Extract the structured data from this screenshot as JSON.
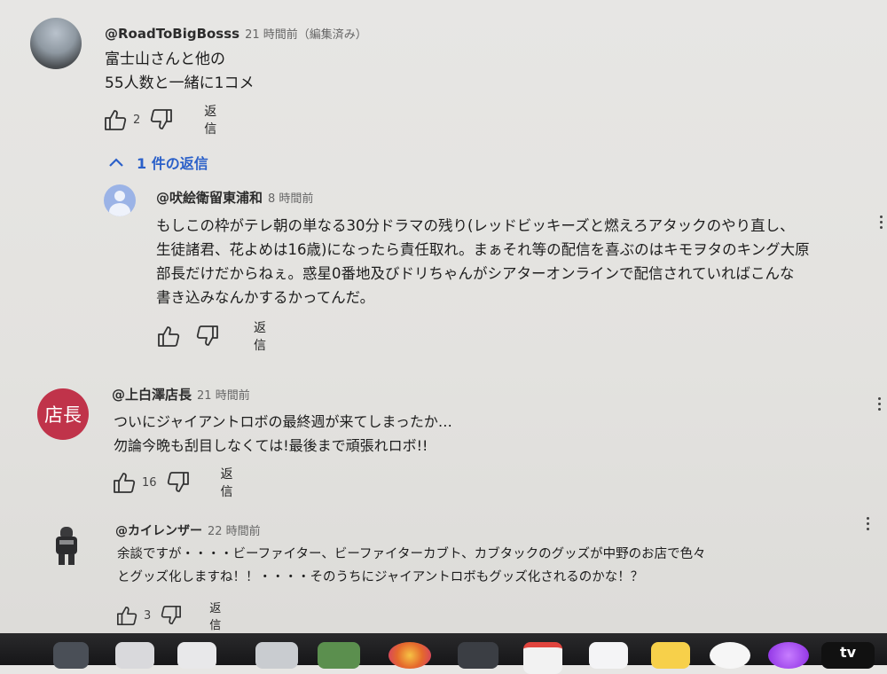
{
  "comments": [
    {
      "handle": "@RoadToBigBosss",
      "time": "21 時間前（編集済み）",
      "lines": [
        "富士山さんと他の",
        "55人数と一緒に1コメ"
      ],
      "likes": "2",
      "reply_label": "返信",
      "replies_toggle": "1 件の返信"
    },
    {
      "handle": "@吠絵衛留東浦和",
      "time": "8 時間前",
      "lines": [
        "もしこの枠がテレ朝の単なる30分ドラマの残り(レッドビッキーズと燃えろアタックのやり直し、",
        "生徒諸君、花よめは16歳)になったら責任取れ。まぁそれ等の配信を喜ぶのはキモヲタのキング大原",
        "部長だけだからねぇ。惑星0番地及びドリちゃんがシアターオンラインで配信されていればこんな",
        "書き込みなんかするかってんだ。"
      ],
      "likes": "",
      "reply_label": "返信"
    },
    {
      "handle": "@上白澤店長",
      "time": "21 時間前",
      "avatar_text": "店長",
      "lines": [
        "ついにジャイアントロボの最終週が来てしまったか…",
        "勿論今晩も刮目しなくては!最後まで頑張れロボ!!"
      ],
      "likes": "16",
      "reply_label": "返信"
    },
    {
      "handle": "@カイレンザー",
      "time": "22 時間前",
      "lines": [
        "余談ですが・・・・ビーファイター、ビーファイターカブト、カブタックのグッズが中野のお店で色々",
        "とグッズ化しますね！！・・・・そのうちにジャイアントロボもグッズ化されるのかな！？"
      ],
      "likes": "3",
      "reply_label": "返信"
    }
  ],
  "icons": [
    "like-icon",
    "dislike-icon",
    "chevron-up-icon",
    "kebab-menu-icon",
    "avatar-person-icon"
  ],
  "colors": {
    "link_blue": "#2b60c9",
    "avatar_red": "#c0334a",
    "avatar_blue": "#9bb3e6"
  },
  "taskbar": {
    "tv_label": "tv"
  }
}
